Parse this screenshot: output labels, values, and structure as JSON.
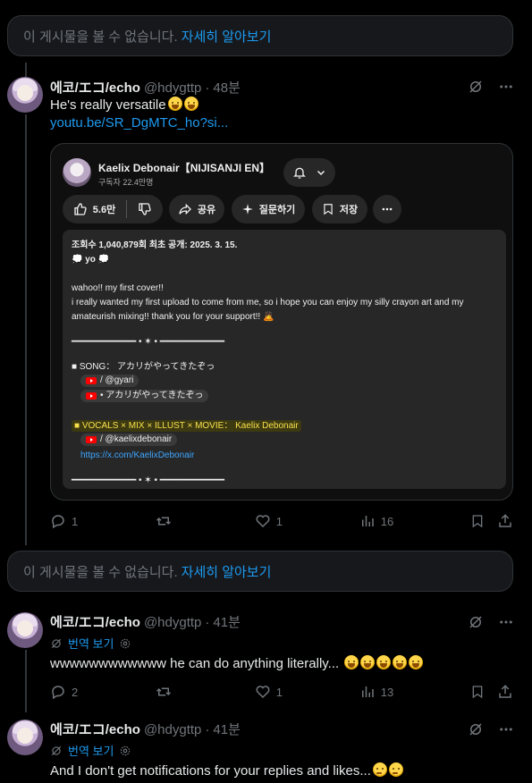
{
  "unavailable": {
    "text": "이 게시물을 볼 수 없습니다.",
    "link": "자세히 알아보기"
  },
  "tweets": [
    {
      "name": "에코/エコ/echo",
      "handle": "@hdygttp",
      "separator": "·",
      "time": "48분",
      "text": "He's really versatile",
      "link": "youtu.be/SR_DgMTC_ho?si...",
      "replies": "1",
      "retweets": "",
      "likes": "1",
      "views": "16"
    },
    {
      "name": "에코/エコ/echo",
      "handle": "@hdygttp",
      "separator": "·",
      "time": "41분",
      "translate": "번역 보기",
      "text": "wwwwwwwwwwww he can do anything literally...",
      "replies": "2",
      "retweets": "",
      "likes": "1",
      "views": "13"
    },
    {
      "name": "에코/エコ/echo",
      "handle": "@hdygttp",
      "separator": "·",
      "time": "41분",
      "translate": "번역 보기",
      "text": "And I don't get notifications for your replies and likes..."
    }
  ],
  "youtube": {
    "channel": "Kaelix Debonair【NIJISANJI EN】",
    "subscribers": "구독자 22.4만명",
    "like_count": "5.6만",
    "share": "공유",
    "ask": "질문하기",
    "save": "저장",
    "description": {
      "stats": "조회수 1,040,879회  최초 공개: 2025. 3. 15.",
      "yo": "💭 yo 💭",
      "line1": "wahoo!! my first cover!!",
      "line2": "i really wanted my first upload to come from me, so i hope you can enjoy my silly crayon art and my",
      "line3": "amateurish mixing!! thank you for your support!! 🙇",
      "separator": "━━━━━━━━━━━━ • ✶ • ━━━━━━━━━━━━",
      "song_label": "■ SONG： アカリがやってきたぞっ",
      "song_chip1": "/ @gyari",
      "song_chip2": "• アカリがやってきたぞっ",
      "credits_label": "■ VOCALS × MIX × ILLUST × MOVIE： Kaelix Debonair",
      "credits_chip": "/ @kaelixdebonair",
      "credits_link": "https://x.com/KaelixDebonair"
    }
  },
  "colors": {
    "accent": "#1d9bf0",
    "background": "#000000",
    "muted": "#71767b",
    "border": "#2f3336"
  }
}
